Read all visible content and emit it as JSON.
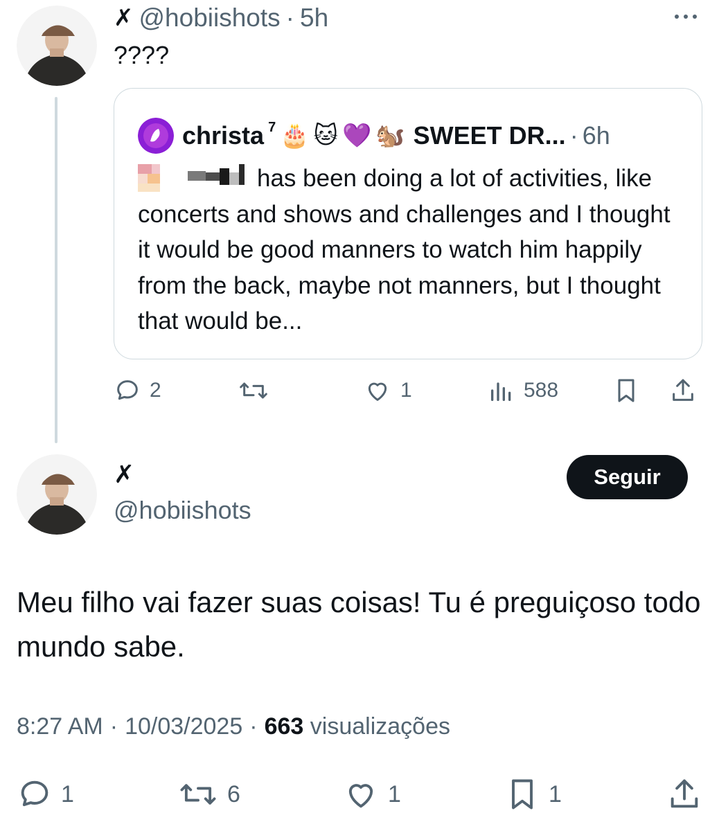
{
  "reply": {
    "display_name": "✗",
    "handle": "@hobiishots",
    "separator": "·",
    "time": "5h",
    "text": "????"
  },
  "quote": {
    "name": "christa",
    "name_sup": "7",
    "emojis": [
      "🎂",
      "🐱",
      "💜",
      "🐿️"
    ],
    "display_name_cont": "SWEET DR...",
    "separator": "·",
    "time": "6h",
    "text_line1": "has been doing a lot of activities,",
    "text_rest": "like concerts and shows and challenges and I thought it would be good manners to watch him happily from the back, maybe not manners, but I thought that would be..."
  },
  "reply_actions": {
    "replies": "2",
    "reposts": "",
    "likes": "1",
    "views": "588"
  },
  "main_tweet": {
    "display_name": "✗",
    "handle": "@hobiishots",
    "follow_label": "Seguir",
    "text": "Meu filho vai fazer suas coisas! Tu é preguiçoso todo mundo sabe.",
    "time": "8:27 AM",
    "separator": "·",
    "date": "10/03/2025",
    "views_count": "663",
    "views_label": "visualizações"
  },
  "main_actions": {
    "replies": "1",
    "reposts": "6",
    "likes": "1",
    "bookmarks": "1"
  },
  "colors": {
    "text": "#0f1419",
    "muted": "#536471",
    "border": "#cfd9de",
    "button_bg": "#0f1419",
    "quote_avatar": "#8b1fd6"
  }
}
